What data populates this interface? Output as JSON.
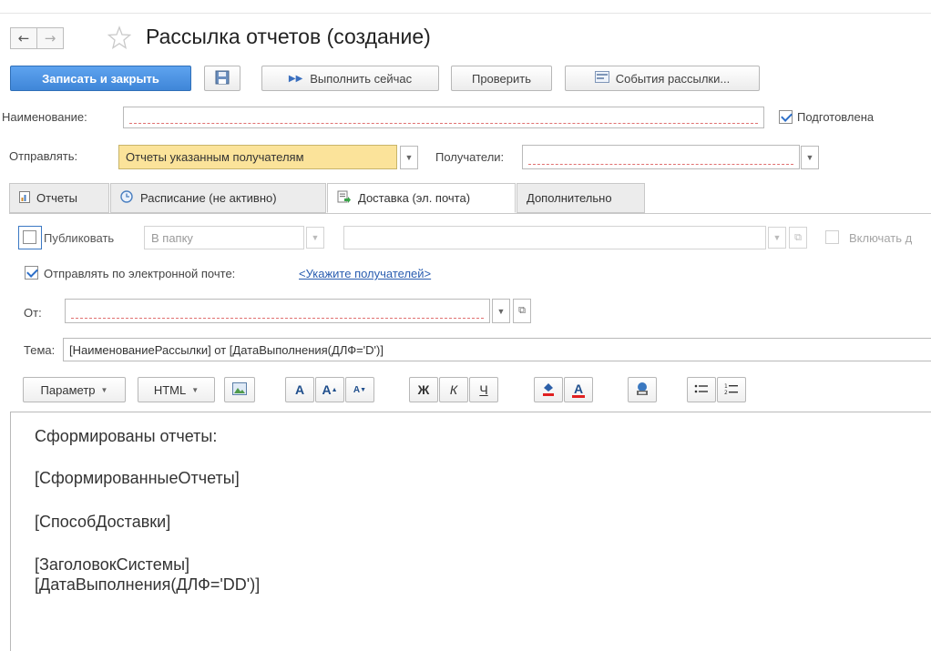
{
  "window": {
    "title": "Рассылка отчетов (создание)"
  },
  "toolbar": {
    "save_close": "Записать и закрыть",
    "run_now": "Выполнить сейчас",
    "check": "Проверить",
    "events": "События рассылки..."
  },
  "form": {
    "name_label": "Наименование:",
    "name_value": "",
    "prepared_label": "Подготовлена",
    "prepared_checked": true,
    "send_label": "Отправлять:",
    "send_value": "Отчеты указанным получателям",
    "recipients_label": "Получатели:",
    "recipients_value": ""
  },
  "tabs": [
    {
      "label": "Отчеты",
      "icon": "report-icon"
    },
    {
      "label": "Расписание (не активно)",
      "icon": "clock-icon"
    },
    {
      "label": "Доставка (эл. почта)",
      "icon": "delivery-icon",
      "active": true
    },
    {
      "label": "Дополнительно"
    }
  ],
  "delivery": {
    "publish_label": "Публиковать",
    "publish_checked": false,
    "folder_value": "В папку",
    "include_label": "Включать д",
    "email_label": "Отправлять по электронной почте:",
    "email_checked": true,
    "recipients_link": "<Укажите получателей>",
    "from_label": "От:",
    "subject_label": "Тема:",
    "subject_value": "[НаименованиеРассылки] от [ДатаВыполнения(ДЛФ='D')]"
  },
  "editor_toolbar": {
    "param_label": "Параметр",
    "html_label": "HTML",
    "font_big": "A",
    "font_up": "A",
    "font_down": "A",
    "bold": "Ж",
    "italic": "К",
    "underline": "Ч",
    "font_color": "A"
  },
  "editor": {
    "lines": [
      "Сформированы отчеты:",
      "[СформированныеОтчеты]",
      "[СпособДоставки]",
      "[ЗаголовокСистемы]",
      "[ДатаВыполнения(ДЛФ='DD')]"
    ]
  },
  "colors": {
    "primary": "#3f86d8",
    "accent_yellow": "#fbe39a",
    "error_underline": "#e07070",
    "link": "#2a5db0"
  }
}
